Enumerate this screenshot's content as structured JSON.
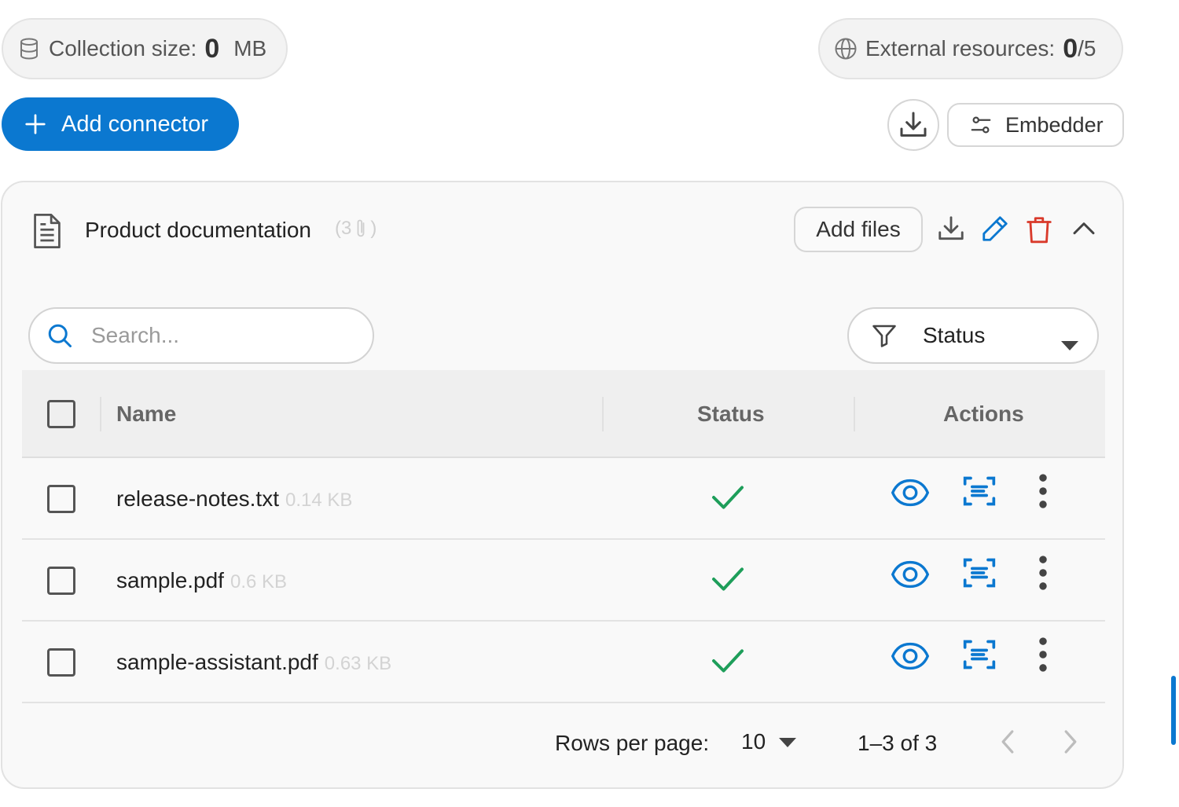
{
  "collection": {
    "label": "Collection size:",
    "value": "0",
    "unit": "MB",
    "icon": "database-icon"
  },
  "external": {
    "label": "External resources:",
    "value": "0",
    "max": "/5",
    "icon": "globe-icon"
  },
  "toolbar": {
    "add_connector_label": "Add connector",
    "embedder_label": "Embedder"
  },
  "card": {
    "title": "Product documentation",
    "count_open": "(3",
    "count_close": ")",
    "add_files_label": "Add files"
  },
  "search": {
    "placeholder": "Search..."
  },
  "filter": {
    "label": "Status"
  },
  "table": {
    "headers": {
      "name": "Name",
      "status": "Status",
      "actions": "Actions"
    },
    "rows": [
      {
        "name": "release-notes.txt",
        "size": "0.14 KB",
        "status": "done"
      },
      {
        "name": "sample.pdf",
        "size": "0.6 KB",
        "status": "done"
      },
      {
        "name": "sample-assistant.pdf",
        "size": "0.63 KB",
        "status": "done"
      }
    ]
  },
  "pagination": {
    "rows_label": "Rows per page:",
    "rows_value": "10",
    "range": "1–3 of 3"
  },
  "colors": {
    "accent": "#0b78d0",
    "success": "#1e9e5a",
    "danger": "#d93a2b"
  }
}
